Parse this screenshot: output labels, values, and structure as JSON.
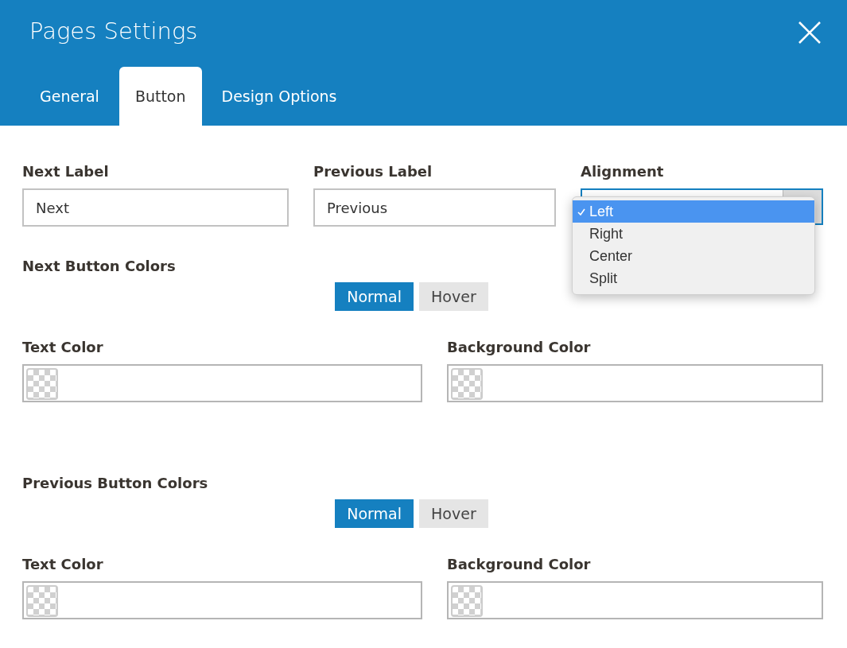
{
  "window": {
    "title": "Pages Settings"
  },
  "tabs": [
    {
      "label": "General",
      "selected": false
    },
    {
      "label": "Button",
      "selected": true
    },
    {
      "label": "Design Options",
      "selected": false
    }
  ],
  "fields": [
    {
      "label": "Next Label",
      "value": "Next"
    },
    {
      "label": "Previous Label",
      "value": "Previous"
    }
  ],
  "alignment": {
    "label": "Alignment",
    "expanded": true,
    "options": [
      {
        "label": "Left",
        "selected": true
      },
      {
        "label": "Right",
        "selected": false
      },
      {
        "label": "Center",
        "selected": false
      },
      {
        "label": "Split",
        "selected": false
      }
    ]
  },
  "color_sections": [
    {
      "title": "Next Button Colors",
      "modes": [
        {
          "label": "Normal",
          "selected": true
        },
        {
          "label": "Hover",
          "selected": false
        }
      ],
      "pickers": [
        {
          "label": "Text Color"
        },
        {
          "label": "Background Color"
        }
      ]
    },
    {
      "title": "Previous Button Colors",
      "modes": [
        {
          "label": "Normal",
          "selected": true
        },
        {
          "label": "Hover",
          "selected": false
        }
      ],
      "pickers": [
        {
          "label": "Text Color"
        },
        {
          "label": "Background Color"
        }
      ]
    }
  ]
}
